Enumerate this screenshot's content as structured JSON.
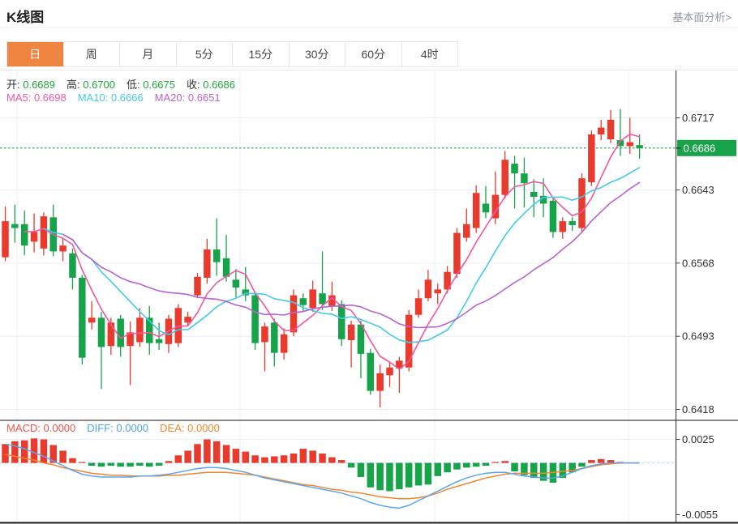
{
  "header": {
    "title": "K线图",
    "analysis_link": "基本面分析>"
  },
  "tabs": {
    "active_index": 0,
    "items": [
      "日",
      "周",
      "月",
      "5分",
      "15分",
      "30分",
      "60分",
      "4时"
    ]
  },
  "ohlc_legend": {
    "items": [
      {
        "label": "开:",
        "value": "0.6689"
      },
      {
        "label": "高:",
        "value": "0.6700"
      },
      {
        "label": "低:",
        "value": "0.6675"
      },
      {
        "label": "收:",
        "value": "0.6686"
      }
    ],
    "value_color": "#1fa73d",
    "label_color": "#333333"
  },
  "ma_legend": {
    "items": [
      {
        "label": "MA5:",
        "value": "0.6698",
        "color": "#f0579f"
      },
      {
        "label": "MA10:",
        "value": "0.6666",
        "color": "#45c9e9"
      },
      {
        "label": "MA20:",
        "value": "0.6651",
        "color": "#b863cf"
      }
    ]
  },
  "macd_legend": {
    "items": [
      {
        "label": "MACD:",
        "value": "0.0000",
        "color": "#f25348"
      },
      {
        "label": "DIFF:",
        "value": "0.0000",
        "color": "#4da2f0"
      },
      {
        "label": "DEA:",
        "value": "0.0000",
        "color": "#f6862c"
      }
    ]
  },
  "colors": {
    "up": "#e83b2d",
    "down": "#17a34a",
    "grid": "#e9eef6",
    "vgrid": "#edf1f8",
    "axis": "#444444",
    "tick_text": "#333333",
    "price_line": "#18a34b",
    "price_tag_bg": "#18a34b",
    "price_tag_text": "#ffffff",
    "ma5": "#f0579f",
    "ma10": "#45c9e9",
    "ma20": "#b863cf",
    "diff_line": "#5ba5ea",
    "dea_line": "#f2862e",
    "zero_line": "#a5d9f2",
    "tab_active_bg": "#ee8540"
  },
  "chart_data": {
    "type": "candlestick",
    "title": "K线图",
    "grid": true,
    "legend_position": "top-left",
    "x_count": 67,
    "panes": [
      {
        "name": "price",
        "ylim": [
          0.6418,
          0.6717
        ],
        "yticks": [
          "0.6717",
          "0.6643",
          "0.6568",
          "0.6493",
          "0.6418"
        ],
        "current_price": 0.6686,
        "current_price_label": "0.6686",
        "last_ohlc": {
          "open": 0.6689,
          "high": 0.67,
          "low": 0.6675,
          "close": 0.6686
        },
        "ma_periods": [
          5,
          10,
          20
        ],
        "ma_last": {
          "MA5": 0.6698,
          "MA10": 0.6666,
          "MA20": 0.6651
        },
        "candles": [
          [
            0.6574,
            0.6626,
            0.657,
            0.6611
          ],
          [
            0.6608,
            0.6628,
            0.6589,
            0.6604
          ],
          [
            0.6608,
            0.6622,
            0.6576,
            0.6586
          ],
          [
            0.659,
            0.6619,
            0.6579,
            0.66
          ],
          [
            0.6583,
            0.662,
            0.6576,
            0.6616
          ],
          [
            0.6615,
            0.6628,
            0.6575,
            0.658
          ],
          [
            0.658,
            0.6593,
            0.657,
            0.6586
          ],
          [
            0.6578,
            0.6583,
            0.6541,
            0.6553
          ],
          [
            0.6553,
            0.6556,
            0.6464,
            0.6471
          ],
          [
            0.6507,
            0.6529,
            0.65,
            0.6512
          ],
          [
            0.6512,
            0.6518,
            0.6439,
            0.6482
          ],
          [
            0.6483,
            0.6512,
            0.6474,
            0.6507
          ],
          [
            0.6511,
            0.6515,
            0.6472,
            0.6482
          ],
          [
            0.6483,
            0.6508,
            0.6443,
            0.6497
          ],
          [
            0.6487,
            0.6522,
            0.6482,
            0.6512
          ],
          [
            0.6512,
            0.6524,
            0.6474,
            0.6486
          ],
          [
            0.649,
            0.6507,
            0.6479,
            0.6486
          ],
          [
            0.6485,
            0.6515,
            0.6476,
            0.6511
          ],
          [
            0.6486,
            0.6526,
            0.6482,
            0.6522
          ],
          [
            0.6507,
            0.6518,
            0.6503,
            0.6513
          ],
          [
            0.6535,
            0.6558,
            0.6532,
            0.6554
          ],
          [
            0.6553,
            0.6593,
            0.6547,
            0.6582
          ],
          [
            0.6582,
            0.6614,
            0.6555,
            0.6569
          ],
          [
            0.6573,
            0.6597,
            0.6549,
            0.6554
          ],
          [
            0.6551,
            0.6562,
            0.6533,
            0.6543
          ],
          [
            0.6541,
            0.6564,
            0.6529,
            0.6535
          ],
          [
            0.6535,
            0.6539,
            0.6479,
            0.6486
          ],
          [
            0.6487,
            0.6507,
            0.6457,
            0.6503
          ],
          [
            0.6507,
            0.6511,
            0.6462,
            0.6476
          ],
          [
            0.6476,
            0.6501,
            0.6469,
            0.6495
          ],
          [
            0.6497,
            0.6541,
            0.6493,
            0.6535
          ],
          [
            0.6532,
            0.6537,
            0.6518,
            0.6525
          ],
          [
            0.6522,
            0.655,
            0.6518,
            0.6541
          ],
          [
            0.6537,
            0.658,
            0.652,
            0.6526
          ],
          [
            0.6524,
            0.6549,
            0.6519,
            0.6535
          ],
          [
            0.6526,
            0.653,
            0.6483,
            0.649
          ],
          [
            0.6489,
            0.6509,
            0.6461,
            0.6505
          ],
          [
            0.6505,
            0.6509,
            0.645,
            0.6475
          ],
          [
            0.6476,
            0.648,
            0.6433,
            0.6437
          ],
          [
            0.6437,
            0.6464,
            0.642,
            0.6455
          ],
          [
            0.6453,
            0.6466,
            0.6441,
            0.6461
          ],
          [
            0.646,
            0.6472,
            0.6435,
            0.6468
          ],
          [
            0.6461,
            0.652,
            0.6457,
            0.6515
          ],
          [
            0.6515,
            0.6541,
            0.6512,
            0.6532
          ],
          [
            0.6532,
            0.6561,
            0.6529,
            0.6551
          ],
          [
            0.6537,
            0.6547,
            0.6526,
            0.6541
          ],
          [
            0.6541,
            0.6565,
            0.6537,
            0.6559
          ],
          [
            0.6557,
            0.6604,
            0.6553,
            0.6599
          ],
          [
            0.6594,
            0.6624,
            0.659,
            0.6608
          ],
          [
            0.6604,
            0.6648,
            0.6599,
            0.664
          ],
          [
            0.6629,
            0.6647,
            0.6614,
            0.662
          ],
          [
            0.6614,
            0.6662,
            0.6608,
            0.6638
          ],
          [
            0.6638,
            0.6683,
            0.6634,
            0.6674
          ],
          [
            0.667,
            0.6678,
            0.6624,
            0.666
          ],
          [
            0.666,
            0.6676,
            0.6625,
            0.665
          ],
          [
            0.6641,
            0.6654,
            0.6615,
            0.6636
          ],
          [
            0.6637,
            0.6655,
            0.6615,
            0.6629
          ],
          [
            0.6632,
            0.6636,
            0.6594,
            0.66
          ],
          [
            0.66,
            0.6615,
            0.6593,
            0.6611
          ],
          [
            0.6611,
            0.6615,
            0.6601,
            0.6607
          ],
          [
            0.6604,
            0.666,
            0.6599,
            0.6655
          ],
          [
            0.6651,
            0.6704,
            0.6647,
            0.67
          ],
          [
            0.67,
            0.6715,
            0.6694,
            0.6707
          ],
          [
            0.6695,
            0.6725,
            0.6691,
            0.6715
          ],
          [
            0.6694,
            0.6726,
            0.6678,
            0.6688
          ],
          [
            0.6688,
            0.6717,
            0.668,
            0.6692
          ],
          [
            0.6689,
            0.67,
            0.6675,
            0.6686
          ]
        ]
      },
      {
        "name": "macd",
        "ylim": [
          -0.0055,
          0.0025
        ],
        "yticks": [
          "0.0025",
          "-0.0055"
        ],
        "last": {
          "MACD": 0.0,
          "DIFF": 0.0,
          "DEA": 0.0
        },
        "histogram": [
          0.002,
          0.0023,
          0.0024,
          0.0026,
          0.0025,
          0.0019,
          0.0013,
          0.0005,
          0.0001,
          -0.0003,
          -0.0004,
          -0.0003,
          -0.0004,
          -0.0004,
          -0.0003,
          -0.0004,
          -0.0003,
          0.0002,
          0.0008,
          0.0013,
          0.002,
          0.0025,
          0.0023,
          0.0019,
          0.0015,
          0.0012,
          0.0008,
          0.0006,
          0.0007,
          0.0008,
          0.001,
          0.0015,
          0.0013,
          0.001,
          0.0006,
          0.0003,
          -0.0005,
          -0.0015,
          -0.0026,
          -0.0029,
          -0.003,
          -0.0028,
          -0.0026,
          -0.0024,
          -0.0023,
          -0.0014,
          -0.001,
          -0.0007,
          -0.0005,
          -0.0004,
          -0.0003,
          0.0001,
          0.0002,
          -0.0009,
          -0.0013,
          -0.0016,
          -0.0019,
          -0.0021,
          -0.0016,
          -0.001,
          -0.0004,
          0.0003,
          0.0004,
          0.0003,
          0.0001,
          0.0,
          0.0
        ],
        "diff": [
          0.002,
          0.0018,
          0.0015,
          0.0011,
          0.0007,
          0.0002,
          -0.0003,
          -0.0008,
          -0.0012,
          -0.0014,
          -0.0015,
          -0.0015,
          -0.0015,
          -0.0015,
          -0.0014,
          -0.0014,
          -0.0013,
          -0.0012,
          -0.001,
          -0.0008,
          -0.0006,
          -0.0005,
          -0.0005,
          -0.0006,
          -0.0008,
          -0.001,
          -0.0013,
          -0.0016,
          -0.0018,
          -0.002,
          -0.0022,
          -0.0024,
          -0.0026,
          -0.0028,
          -0.003,
          -0.0032,
          -0.0035,
          -0.0038,
          -0.0042,
          -0.0045,
          -0.0047,
          -0.0048,
          -0.0045,
          -0.004,
          -0.0035,
          -0.003,
          -0.0025,
          -0.002,
          -0.0016,
          -0.0013,
          -0.0011,
          -0.001,
          -0.001,
          -0.0012,
          -0.0014,
          -0.0015,
          -0.0016,
          -0.0016,
          -0.0014,
          -0.001,
          -0.0006,
          -0.0003,
          -0.0001,
          0.0,
          0.0,
          0.0,
          0.0
        ],
        "dea": [
          0.0009,
          0.0007,
          0.0005,
          0.0003,
          0.0,
          -0.0002,
          -0.0005,
          -0.0007,
          -0.0009,
          -0.0011,
          -0.0012,
          -0.0013,
          -0.0013,
          -0.0014,
          -0.0014,
          -0.0014,
          -0.0014,
          -0.0013,
          -0.0013,
          -0.0012,
          -0.0011,
          -0.001,
          -0.001,
          -0.001,
          -0.0011,
          -0.0012,
          -0.0013,
          -0.0015,
          -0.0017,
          -0.0019,
          -0.0021,
          -0.0023,
          -0.0024,
          -0.0026,
          -0.0028,
          -0.0029,
          -0.0031,
          -0.0032,
          -0.0034,
          -0.0036,
          -0.0037,
          -0.0038,
          -0.0038,
          -0.0037,
          -0.0035,
          -0.0032,
          -0.0028,
          -0.0025,
          -0.0022,
          -0.0019,
          -0.0016,
          -0.0014,
          -0.0012,
          -0.0011,
          -0.0011,
          -0.0011,
          -0.0011,
          -0.001,
          -0.0009,
          -0.0008,
          -0.0006,
          -0.0004,
          -0.0002,
          -0.0001,
          0.0,
          0.0,
          0.0
        ]
      }
    ]
  }
}
